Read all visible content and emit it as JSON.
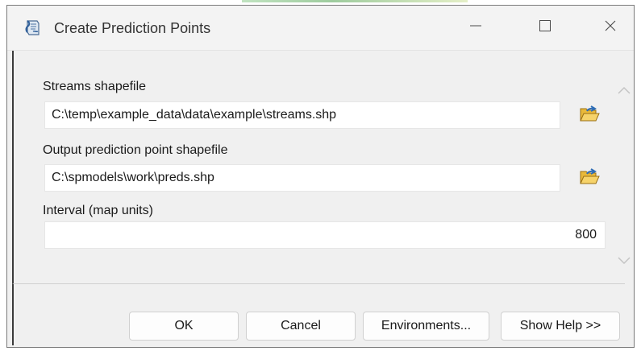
{
  "window": {
    "title": "Create Prediction Points",
    "icon": "toolbox-script-icon",
    "controls": [
      "minimize-icon",
      "maximize-icon",
      "close-icon"
    ]
  },
  "form": {
    "streams": {
      "label": "Streams shapefile",
      "value": "C:\\temp\\example_data\\data\\example\\streams.shp",
      "browse_icon": "open-folder-icon"
    },
    "output": {
      "label": "Output prediction point shapefile",
      "value": "C:\\spmodels\\work\\preds.shp",
      "browse_icon": "open-folder-icon"
    },
    "interval": {
      "label": "Interval (map units)",
      "value": "800"
    }
  },
  "buttons": {
    "ok": "OK",
    "cancel": "Cancel",
    "environments": "Environments...",
    "help": "Show Help >>"
  },
  "colors": {
    "dialog_bg": "#f0f0f0",
    "input_bg": "#ffffff",
    "folder_yellow": "#e9b93a"
  }
}
